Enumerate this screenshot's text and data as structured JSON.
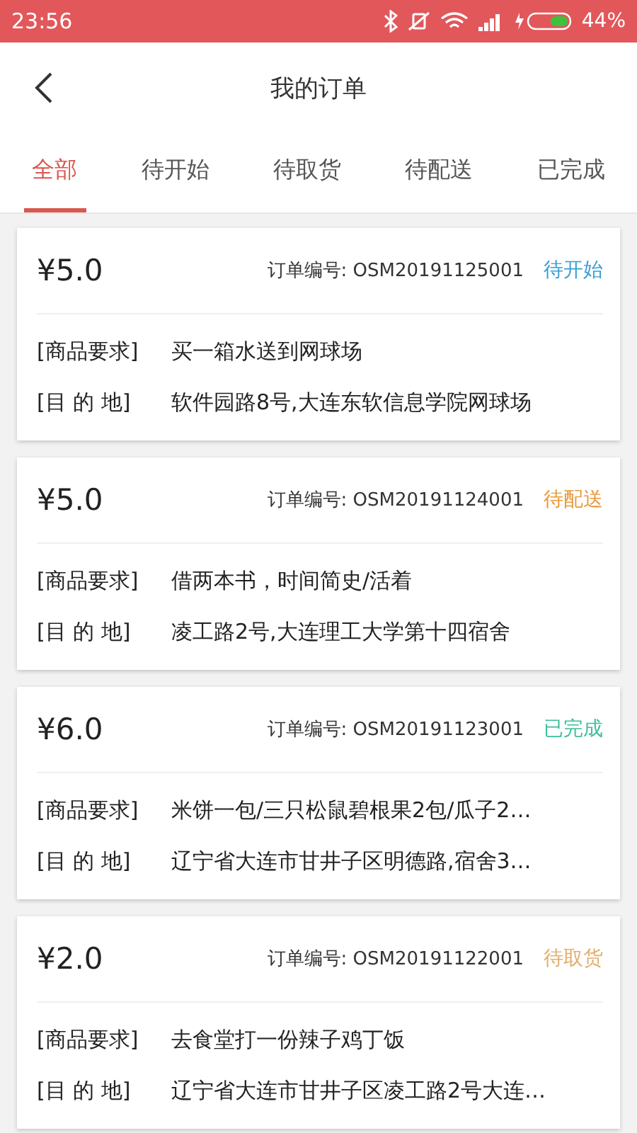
{
  "status_bar": {
    "time": "23:56",
    "battery": "44%"
  },
  "header": {
    "title": "我的订单"
  },
  "tabs": [
    {
      "label": "全部",
      "selected": true
    },
    {
      "label": "待开始",
      "selected": false
    },
    {
      "label": "待取货",
      "selected": false
    },
    {
      "label": "待配送",
      "selected": false
    },
    {
      "label": "已完成",
      "selected": false
    }
  ],
  "orders": [
    {
      "price": "¥5.0",
      "number_label": "订单编号:",
      "number": "OSM20191125001",
      "status": "待开始",
      "color": "#3a9fd4",
      "goods_label": "[商品要求]",
      "goods": "买一箱水送到网球场",
      "dest_label": "[目 的 地]",
      "dest": "软件园路8号,大连东软信息学院网球场"
    },
    {
      "price": "¥5.0",
      "number_label": "订单编号:",
      "number": "OSM20191124001",
      "status": "待配送",
      "color": "#e89a3c",
      "goods_label": "[商品要求]",
      "goods": "借两本书，时间简史/活着",
      "dest_label": "[目 的 地]",
      "dest": "凌工路2号,大连理工大学第十四宿舍"
    },
    {
      "price": "¥6.0",
      "number_label": "订单编号:",
      "number": "OSM20191123001",
      "status": "已完成",
      "color": "#3cbf9a",
      "goods_label": "[商品要求]",
      "goods": "米饼一包/三只松鼠碧根果2包/瓜子2…",
      "dest_label": "[目 的 地]",
      "dest": "辽宁省大连市甘井子区明德路,宿舍3…"
    },
    {
      "price": "¥2.0",
      "number_label": "订单编号:",
      "number": "OSM20191122001",
      "status": "待取货",
      "color": "#e4ad6a",
      "goods_label": "[商品要求]",
      "goods": "去食堂打一份辣子鸡丁饭",
      "dest_label": "[目 的 地]",
      "dest": "辽宁省大连市甘井子区凌工路2号大连…"
    }
  ]
}
